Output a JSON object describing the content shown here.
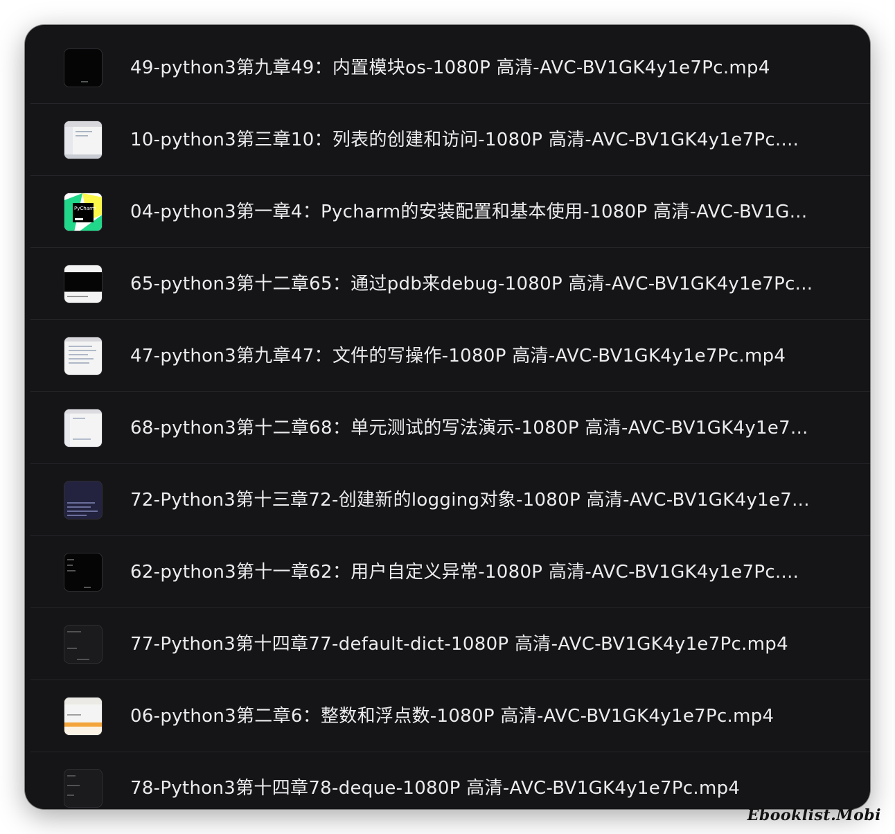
{
  "files": [
    {
      "name": "49-python3第九章49：内置模块os-1080P 高清-AVC-BV1GK4y1e7Pc.mp4",
      "thumb": "dark-terminal"
    },
    {
      "name": "10-python3第三章10：列表的创建和访问-1080P 高清-AVC-BV1GK4y1e7Pc....",
      "thumb": "white-ide"
    },
    {
      "name": "04-python3第一章4：Pycharm的安装配置和基本使用-1080P 高清-AVC-BV1G...",
      "thumb": "pycharm-logo"
    },
    {
      "name": "65-python3第十二章65：通过pdb来debug-1080P 高清-AVC-BV1GK4y1e7Pc...",
      "thumb": "white-black-screen"
    },
    {
      "name": "47-python3第九章47：文件的写操作-1080P 高清-AVC-BV1GK4y1e7Pc.mp4",
      "thumb": "white-ide"
    },
    {
      "name": "68-python3第十二章68：单元测试的写法演示-1080P 高清-AVC-BV1GK4y1e7...",
      "thumb": "white-ide"
    },
    {
      "name": "72-Python3第十三章72-创建新的logging对象-1080P 高清-AVC-BV1GK4y1e7...",
      "thumb": "navy-code"
    },
    {
      "name": "62-python3第十一章62：用户自定义异常-1080P 高清-AVC-BV1GK4y1e7Pc....",
      "thumb": "dark-terminal"
    },
    {
      "name": "77-Python3第十四章77-default-dict-1080P 高清-AVC-BV1GK4y1e7Pc.mp4",
      "thumb": "dark-code"
    },
    {
      "name": "06-python3第二章6：整数和浮点数-1080P 高清-AVC-BV1GK4y1e7Pc.mp4",
      "thumb": "white-orange"
    },
    {
      "name": "78-Python3第十四章78-deque-1080P 高清-AVC-BV1GK4y1e7Pc.mp4",
      "thumb": "dark-code"
    }
  ],
  "watermark": "Ebooklist.Mobi"
}
